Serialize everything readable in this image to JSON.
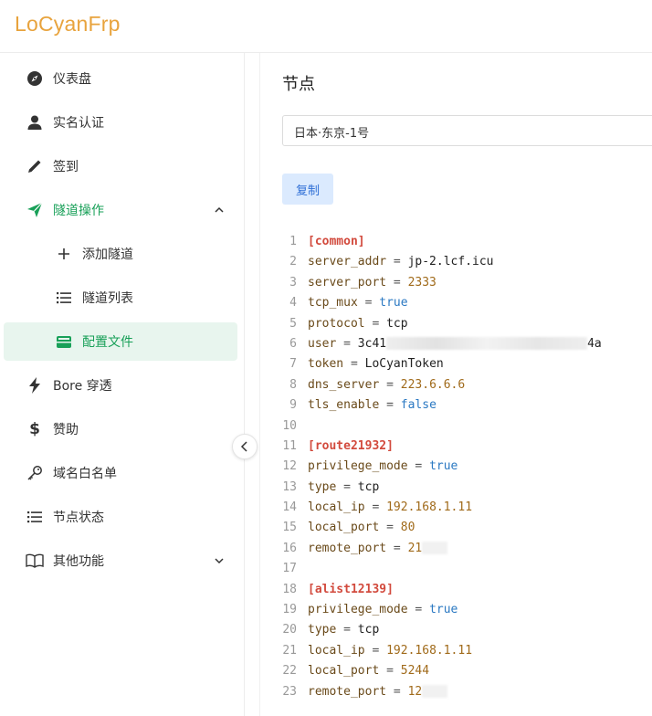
{
  "app": {
    "title": "LoCyanFrp"
  },
  "sidebar": {
    "items": [
      {
        "label": "仪表盘",
        "icon": "compass-icon"
      },
      {
        "label": "实名认证",
        "icon": "user-icon"
      },
      {
        "label": "签到",
        "icon": "pencil-icon"
      },
      {
        "label": "隧道操作",
        "icon": "send-icon",
        "expanded": true
      },
      {
        "label": "添加隧道",
        "icon": "plus-icon"
      },
      {
        "label": "隧道列表",
        "icon": "list-icon"
      },
      {
        "label": "配置文件",
        "icon": "wallet-icon",
        "active": true
      },
      {
        "label": "Bore 穿透",
        "icon": "bolt-icon"
      },
      {
        "label": "赞助",
        "icon": "dollar-icon"
      },
      {
        "label": "域名白名单",
        "icon": "key-icon"
      },
      {
        "label": "节点状态",
        "icon": "list-icon"
      },
      {
        "label": "其他功能",
        "icon": "book-icon",
        "expanded": false
      }
    ]
  },
  "main": {
    "title": "节点",
    "node_select": {
      "value": "日本·东京-1号"
    },
    "copy_label": "复制",
    "config_lines": [
      {
        "n": "1",
        "section": "[common]"
      },
      {
        "n": "2",
        "key": "server_addr",
        "value": "jp-2.lcf.icu",
        "type": "str"
      },
      {
        "n": "3",
        "key": "server_port",
        "value": "2333",
        "type": "num"
      },
      {
        "n": "4",
        "key": "tcp_mux",
        "value": "true",
        "type": "bool"
      },
      {
        "n": "5",
        "key": "protocol",
        "value": "tcp",
        "type": "str"
      },
      {
        "n": "6",
        "key": "user",
        "value": "3c41",
        "tail": "4a",
        "redacted": true
      },
      {
        "n": "7",
        "key": "token",
        "value": "LoCyanToken",
        "type": "str"
      },
      {
        "n": "8",
        "key": "dns_server",
        "value": "223.6.6.6",
        "type": "num"
      },
      {
        "n": "9",
        "key": "tls_enable",
        "value": "false",
        "type": "bool"
      },
      {
        "n": "10"
      },
      {
        "n": "11",
        "section": "[route21932]"
      },
      {
        "n": "12",
        "key": "privilege_mode",
        "value": "true",
        "type": "bool"
      },
      {
        "n": "13",
        "key": "type",
        "value": "tcp",
        "type": "str"
      },
      {
        "n": "14",
        "key": "local_ip",
        "value": "192.168.1.11",
        "type": "num"
      },
      {
        "n": "15",
        "key": "local_port",
        "value": "80",
        "type": "num"
      },
      {
        "n": "16",
        "key": "remote_port",
        "value": "21",
        "type": "num",
        "redacted_short": true
      },
      {
        "n": "17"
      },
      {
        "n": "18",
        "section": "[alist12139]"
      },
      {
        "n": "19",
        "key": "privilege_mode",
        "value": "true",
        "type": "bool"
      },
      {
        "n": "20",
        "key": "type",
        "value": "tcp",
        "type": "str"
      },
      {
        "n": "21",
        "key": "local_ip",
        "value": "192.168.1.11",
        "type": "num"
      },
      {
        "n": "22",
        "key": "local_port",
        "value": "5244",
        "type": "num"
      },
      {
        "n": "23",
        "key": "remote_port",
        "value": "12",
        "type": "num",
        "redacted_short": true
      }
    ]
  },
  "colors": {
    "brand": "#e8a33d",
    "accent": "#18a058",
    "active_bg": "#e8f5ee",
    "copy_bg": "#dbeafe"
  }
}
